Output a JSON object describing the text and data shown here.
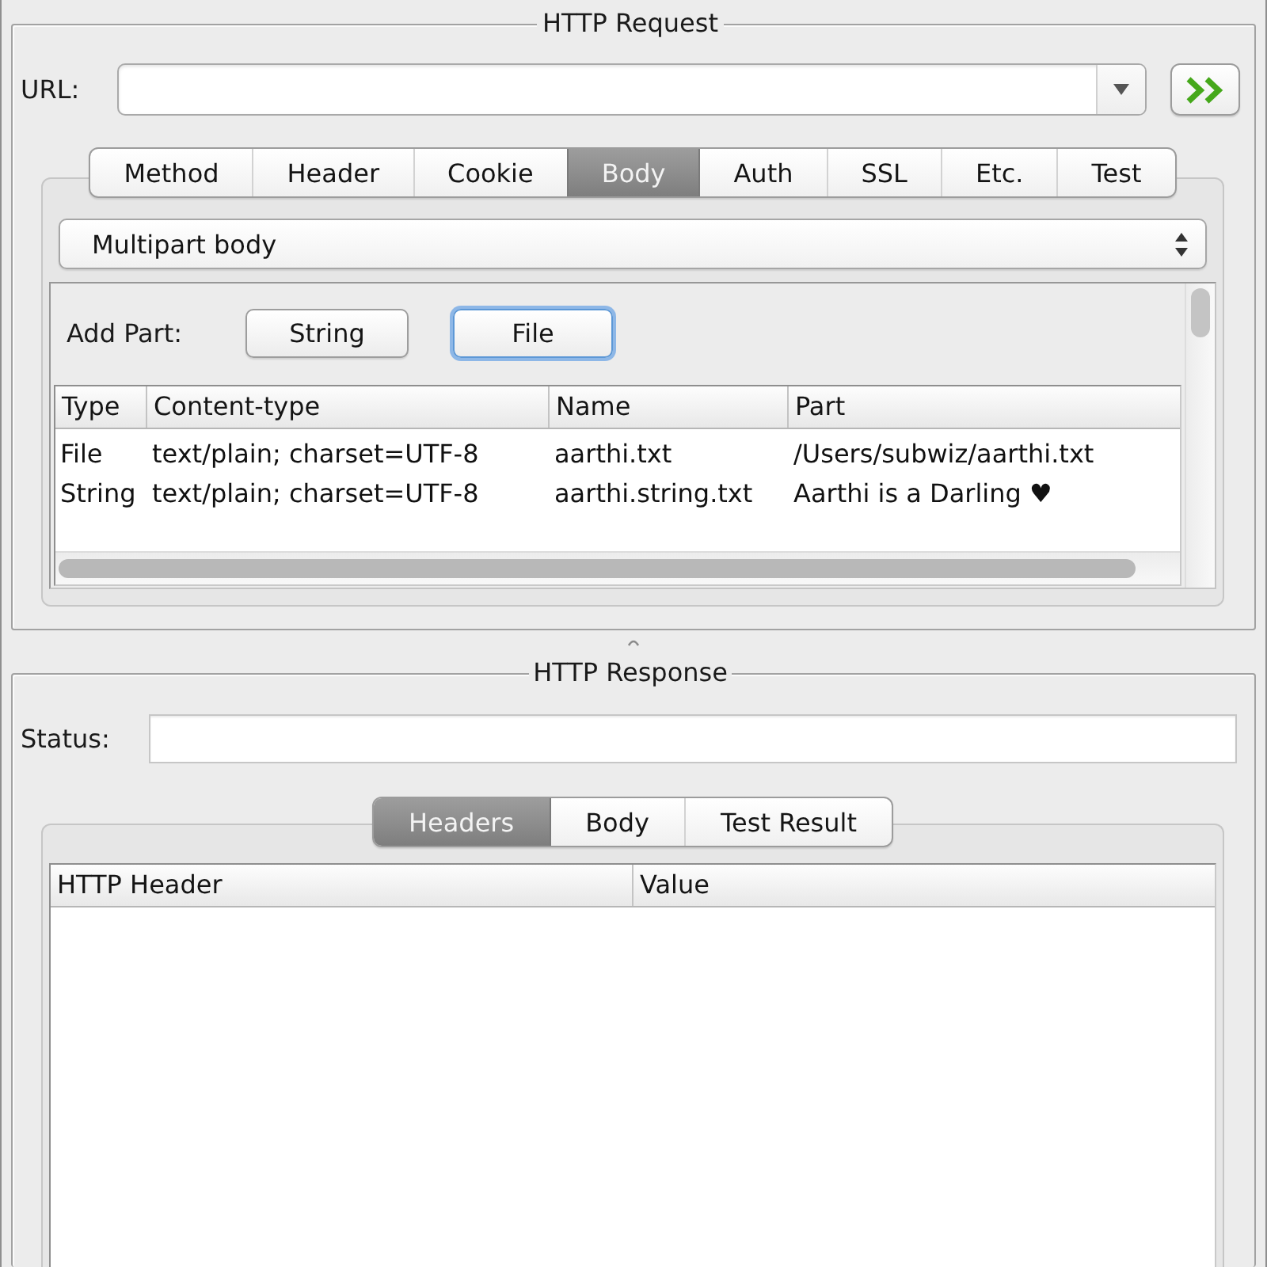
{
  "request": {
    "title": "HTTP Request",
    "url": {
      "label": "URL:"
    },
    "tabs": [
      {
        "label": "Method",
        "selected": false
      },
      {
        "label": "Header",
        "selected": false
      },
      {
        "label": "Cookie",
        "selected": false
      },
      {
        "label": "Body",
        "selected": true
      },
      {
        "label": "Auth",
        "selected": false
      },
      {
        "label": "SSL",
        "selected": false
      },
      {
        "label": "Etc.",
        "selected": false
      },
      {
        "label": "Test",
        "selected": false
      }
    ],
    "body": {
      "body_type": "Multipart body",
      "add_part": {
        "label": "Add Part:",
        "buttons": [
          {
            "label": "String",
            "focused": false
          },
          {
            "label": "File",
            "focused": true
          }
        ]
      },
      "table": {
        "columns": [
          "Type",
          "Content-type",
          "Name",
          "Part"
        ],
        "rows": [
          [
            "File",
            "text/plain; charset=UTF-8",
            "aarthi.txt",
            "/Users/subwiz/aarthi.txt"
          ],
          [
            "String",
            "text/plain; charset=UTF-8",
            "aarthi.string.txt",
            "Aarthi is a Darling ♥"
          ]
        ]
      }
    }
  },
  "response": {
    "title": "HTTP Response",
    "status": {
      "label": "Status:"
    },
    "tabs": [
      {
        "label": "Headers",
        "selected": true
      },
      {
        "label": "Body",
        "selected": false
      },
      {
        "label": "Test Result",
        "selected": false
      }
    ],
    "table": {
      "columns": [
        "HTTP Header",
        "Value"
      ]
    }
  }
}
